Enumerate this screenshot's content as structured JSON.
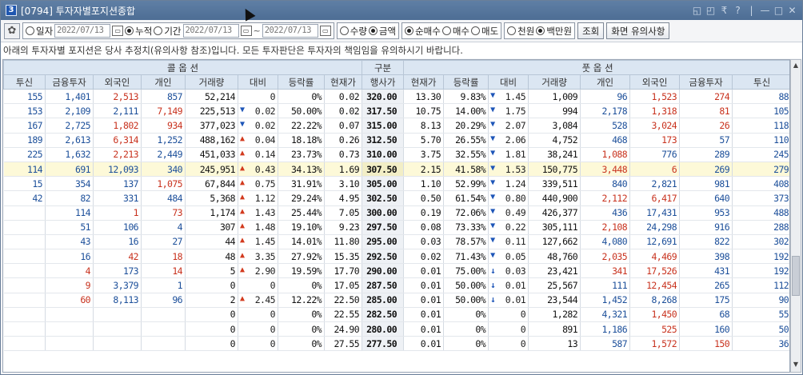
{
  "window": {
    "badge": "3",
    "title": "[0794] 투자자별포지션종합",
    "controls": [
      "◱",
      "◰",
      "₹",
      "?",
      "|",
      "—",
      "□",
      "✕"
    ]
  },
  "toolbar": {
    "gear_icon": "✿",
    "date_mode": {
      "options": [
        {
          "label": "일자",
          "selected": false
        },
        {
          "label": "누적",
          "selected": true
        },
        {
          "label": "기간",
          "selected": false
        }
      ]
    },
    "date_single": "2022/07/13",
    "date_from": "2022/07/13",
    "date_sep": "~",
    "date_to": "2022/07/13",
    "qty_mode": {
      "options": [
        {
          "label": "수량",
          "selected": false
        },
        {
          "label": "금액",
          "selected": true
        }
      ]
    },
    "trade_mode": {
      "options": [
        {
          "label": "순매수",
          "selected": true
        },
        {
          "label": "매수",
          "selected": false
        },
        {
          "label": "매도",
          "selected": false
        }
      ]
    },
    "unit_mode": {
      "options": [
        {
          "label": "천원",
          "selected": false
        },
        {
          "label": "백만원",
          "selected": true
        }
      ]
    },
    "search_label": "조회",
    "notice_label": "화면 유의사항"
  },
  "notice": "아래의 투자자별 포지션은 당사 추정치(유의사항 참조)입니다. 모든 투자판단은 투자자의 책임임을 유의하시기 바랍니다.",
  "table": {
    "group_headers": {
      "call": "콜 옵 션",
      "mid": "구분",
      "put": "풋 옵 션"
    },
    "columns": [
      "투신",
      "금융투자",
      "외국인",
      "개인",
      "거래량",
      "대비",
      "등락률",
      "현재가",
      "행사가",
      "현재가",
      "등락률",
      "대비",
      "거래량",
      "개인",
      "외국인",
      "금융투자",
      "투신"
    ],
    "rows": [
      {
        "c": [
          [
            "155",
            "b"
          ],
          [
            "1,401",
            "b"
          ],
          [
            "2,513",
            "r"
          ],
          [
            "857",
            "b"
          ],
          [
            "52,214",
            "k"
          ]
        ],
        "cd": [
          "",
          "0"
        ],
        "cr": "0%",
        "cp": "0.02",
        "strike": "320.00",
        "pp": "13.30",
        "pr": "9.83%",
        "pd": [
          "▼",
          "1.45"
        ],
        "p": [
          [
            "1,009",
            "k"
          ],
          [
            "96",
            "b"
          ],
          [
            "1,523",
            "r"
          ],
          [
            "274",
            "r"
          ],
          [
            "88",
            "b"
          ]
        ]
      },
      {
        "c": [
          [
            "153",
            "b"
          ],
          [
            "2,109",
            "b"
          ],
          [
            "2,111",
            "b"
          ],
          [
            "7,149",
            "r"
          ],
          [
            "225,513",
            "k"
          ]
        ],
        "cd": [
          "▼",
          "0.02"
        ],
        "cr": "50.00%",
        "cp": "0.02",
        "strike": "317.50",
        "pp": "10.75",
        "pr": "14.00%",
        "pd": [
          "▼",
          "1.75"
        ],
        "p": [
          [
            "994",
            "k"
          ],
          [
            "2,178",
            "b"
          ],
          [
            "1,318",
            "r"
          ],
          [
            "81",
            "r"
          ],
          [
            "105",
            "b"
          ]
        ]
      },
      {
        "c": [
          [
            "167",
            "b"
          ],
          [
            "2,725",
            "b"
          ],
          [
            "1,802",
            "r"
          ],
          [
            "934",
            "r"
          ],
          [
            "377,023",
            "k"
          ]
        ],
        "cd": [
          "▼",
          "0.02"
        ],
        "cr": "22.22%",
        "cp": "0.07",
        "strike": "315.00",
        "pp": "8.13",
        "pr": "20.29%",
        "pd": [
          "▼",
          "2.07"
        ],
        "p": [
          [
            "3,084",
            "k"
          ],
          [
            "528",
            "b"
          ],
          [
            "3,024",
            "r"
          ],
          [
            "26",
            "r"
          ],
          [
            "118",
            "b"
          ]
        ]
      },
      {
        "c": [
          [
            "189",
            "b"
          ],
          [
            "2,613",
            "b"
          ],
          [
            "6,314",
            "r"
          ],
          [
            "1,252",
            "b"
          ],
          [
            "488,162",
            "k"
          ]
        ],
        "cd": [
          "▲",
          "0.04"
        ],
        "cr": "18.18%",
        "cp": "0.26",
        "strike": "312.50",
        "pp": "5.70",
        "pr": "26.55%",
        "pd": [
          "▼",
          "2.06"
        ],
        "p": [
          [
            "4,752",
            "k"
          ],
          [
            "468",
            "b"
          ],
          [
            "173",
            "r"
          ],
          [
            "57",
            "b"
          ],
          [
            "110",
            "b"
          ]
        ]
      },
      {
        "c": [
          [
            "225",
            "b"
          ],
          [
            "1,632",
            "b"
          ],
          [
            "2,213",
            "r"
          ],
          [
            "2,449",
            "b"
          ],
          [
            "451,033",
            "k"
          ]
        ],
        "cd": [
          "▲",
          "0.14"
        ],
        "cr": "23.73%",
        "cp": "0.73",
        "strike": "310.00",
        "pp": "3.75",
        "pr": "32.55%",
        "pd": [
          "▼",
          "1.81"
        ],
        "p": [
          [
            "38,241",
            "k"
          ],
          [
            "1,088",
            "r"
          ],
          [
            "776",
            "b"
          ],
          [
            "289",
            "b"
          ],
          [
            "245",
            "b"
          ]
        ]
      },
      {
        "hl": true,
        "c": [
          [
            "114",
            "b"
          ],
          [
            "691",
            "b"
          ],
          [
            "12,093",
            "b"
          ],
          [
            "340",
            "b"
          ],
          [
            "245,951",
            "k"
          ]
        ],
        "cd": [
          "▲",
          "0.43"
        ],
        "cr": "34.13%",
        "cp": "1.69",
        "strike": "307.50",
        "pp": "2.15",
        "pr": "41.58%",
        "pd": [
          "▼",
          "1.53"
        ],
        "p": [
          [
            "150,775",
            "k"
          ],
          [
            "3,448",
            "r"
          ],
          [
            "6",
            "r"
          ],
          [
            "269",
            "b"
          ],
          [
            "279",
            "b"
          ]
        ]
      },
      {
        "c": [
          [
            "15",
            "b"
          ],
          [
            "354",
            "b"
          ],
          [
            "137",
            "b"
          ],
          [
            "1,075",
            "r"
          ],
          [
            "67,844",
            "k"
          ]
        ],
        "cd": [
          "▲",
          "0.75"
        ],
        "cr": "31.91%",
        "cp": "3.10",
        "strike": "305.00",
        "pp": "1.10",
        "pr": "52.99%",
        "pd": [
          "▼",
          "1.24"
        ],
        "p": [
          [
            "339,511",
            "k"
          ],
          [
            "840",
            "b"
          ],
          [
            "2,821",
            "b"
          ],
          [
            "981",
            "b"
          ],
          [
            "408",
            "b"
          ]
        ]
      },
      {
        "c": [
          [
            "42",
            "b"
          ],
          [
            "82",
            "b"
          ],
          [
            "331",
            "b"
          ],
          [
            "484",
            "b"
          ],
          [
            "5,368",
            "k"
          ]
        ],
        "cd": [
          "▲",
          "1.12"
        ],
        "cr": "29.24%",
        "cp": "4.95",
        "strike": "302.50",
        "pp": "0.50",
        "pr": "61.54%",
        "pd": [
          "▼",
          "0.80"
        ],
        "p": [
          [
            "440,900",
            "k"
          ],
          [
            "2,112",
            "r"
          ],
          [
            "6,417",
            "r"
          ],
          [
            "640",
            "b"
          ],
          [
            "373",
            "b"
          ]
        ]
      },
      {
        "c": [
          [
            "",
            ""
          ],
          [
            "114",
            "b"
          ],
          [
            "1",
            "r"
          ],
          [
            "73",
            "r"
          ],
          [
            "1,174",
            "k"
          ]
        ],
        "cd": [
          "▲",
          "1.43"
        ],
        "cr": "25.44%",
        "cp": "7.05",
        "strike": "300.00",
        "pp": "0.19",
        "pr": "72.06%",
        "pd": [
          "▼",
          "0.49"
        ],
        "p": [
          [
            "426,377",
            "k"
          ],
          [
            "436",
            "b"
          ],
          [
            "17,431",
            "b"
          ],
          [
            "953",
            "b"
          ],
          [
            "488",
            "b"
          ]
        ]
      },
      {
        "c": [
          [
            "",
            ""
          ],
          [
            "51",
            "b"
          ],
          [
            "106",
            "b"
          ],
          [
            "4",
            "b"
          ],
          [
            "307",
            "k"
          ]
        ],
        "cd": [
          "▲",
          "1.48"
        ],
        "cr": "19.10%",
        "cp": "9.23",
        "strike": "297.50",
        "pp": "0.08",
        "pr": "73.33%",
        "pd": [
          "▼",
          "0.22"
        ],
        "p": [
          [
            "305,111",
            "k"
          ],
          [
            "2,108",
            "r"
          ],
          [
            "24,298",
            "b"
          ],
          [
            "916",
            "b"
          ],
          [
            "288",
            "b"
          ]
        ]
      },
      {
        "c": [
          [
            "",
            ""
          ],
          [
            "43",
            "b"
          ],
          [
            "16",
            "b"
          ],
          [
            "27",
            "b"
          ],
          [
            "44",
            "k"
          ]
        ],
        "cd": [
          "▲",
          "1.45"
        ],
        "cr": "14.01%",
        "cp": "11.80",
        "strike": "295.00",
        "pp": "0.03",
        "pr": "78.57%",
        "pd": [
          "▼",
          "0.11"
        ],
        "p": [
          [
            "127,662",
            "k"
          ],
          [
            "4,080",
            "b"
          ],
          [
            "12,691",
            "b"
          ],
          [
            "822",
            "b"
          ],
          [
            "302",
            "b"
          ]
        ]
      },
      {
        "c": [
          [
            "",
            ""
          ],
          [
            "16",
            "b"
          ],
          [
            "42",
            "r"
          ],
          [
            "18",
            "r"
          ],
          [
            "48",
            "k"
          ]
        ],
        "cd": [
          "▲",
          "3.35"
        ],
        "cr": "27.92%",
        "cp": "15.35",
        "strike": "292.50",
        "pp": "0.02",
        "pr": "71.43%",
        "pd": [
          "▼",
          "0.05"
        ],
        "p": [
          [
            "48,760",
            "k"
          ],
          [
            "2,035",
            "r"
          ],
          [
            "4,469",
            "r"
          ],
          [
            "398",
            "b"
          ],
          [
            "192",
            "b"
          ]
        ]
      },
      {
        "c": [
          [
            "",
            ""
          ],
          [
            "4",
            "r"
          ],
          [
            "173",
            "b"
          ],
          [
            "14",
            "r"
          ],
          [
            "5",
            "k"
          ]
        ],
        "cd": [
          "▲",
          "2.90"
        ],
        "cr": "19.59%",
        "cp": "17.70",
        "strike": "290.00",
        "pp": "0.01",
        "pr": "75.00%",
        "pd": [
          "↓",
          "0.03"
        ],
        "p": [
          [
            "23,421",
            "k"
          ],
          [
            "341",
            "r"
          ],
          [
            "17,526",
            "r"
          ],
          [
            "431",
            "b"
          ],
          [
            "192",
            "b"
          ]
        ]
      },
      {
        "c": [
          [
            "",
            ""
          ],
          [
            "9",
            "r"
          ],
          [
            "3,379",
            "b"
          ],
          [
            "1",
            "b"
          ],
          [
            "0",
            "k"
          ]
        ],
        "cd": [
          "",
          "0"
        ],
        "cr": "0%",
        "cp": "17.05",
        "strike": "287.50",
        "pp": "0.01",
        "pr": "50.00%",
        "pd": [
          "↓",
          "0.01"
        ],
        "p": [
          [
            "25,567",
            "k"
          ],
          [
            "111",
            "b"
          ],
          [
            "12,454",
            "r"
          ],
          [
            "265",
            "b"
          ],
          [
            "112",
            "b"
          ]
        ]
      },
      {
        "c": [
          [
            "",
            ""
          ],
          [
            "60",
            "r"
          ],
          [
            "8,113",
            "b"
          ],
          [
            "96",
            "b"
          ],
          [
            "2",
            "k"
          ]
        ],
        "cd": [
          "▲",
          "2.45"
        ],
        "cr": "12.22%",
        "cp": "22.50",
        "strike": "285.00",
        "pp": "0.01",
        "pr": "50.00%",
        "pd": [
          "↓",
          "0.01"
        ],
        "p": [
          [
            "23,544",
            "k"
          ],
          [
            "1,452",
            "b"
          ],
          [
            "8,268",
            "b"
          ],
          [
            "175",
            "b"
          ],
          [
            "90",
            "b"
          ]
        ]
      },
      {
        "c": [
          [
            "",
            ""
          ],
          [
            "",
            ""
          ],
          [
            "",
            ""
          ],
          [
            "",
            ""
          ],
          [
            "0",
            "k"
          ]
        ],
        "cd": [
          "",
          "0"
        ],
        "cr": "0%",
        "cp": "22.55",
        "strike": "282.50",
        "pp": "0.01",
        "pr": "0%",
        "pd": [
          "",
          "0"
        ],
        "p": [
          [
            "1,282",
            "k"
          ],
          [
            "4,321",
            "b"
          ],
          [
            "1,450",
            "r"
          ],
          [
            "68",
            "b"
          ],
          [
            "55",
            "b"
          ]
        ]
      },
      {
        "c": [
          [
            "",
            ""
          ],
          [
            "",
            ""
          ],
          [
            "",
            ""
          ],
          [
            "",
            ""
          ],
          [
            "0",
            "k"
          ]
        ],
        "cd": [
          "",
          "0"
        ],
        "cr": "0%",
        "cp": "24.90",
        "strike": "280.00",
        "pp": "0.01",
        "pr": "0%",
        "pd": [
          "",
          "0"
        ],
        "p": [
          [
            "891",
            "k"
          ],
          [
            "1,186",
            "b"
          ],
          [
            "525",
            "r"
          ],
          [
            "160",
            "b"
          ],
          [
            "50",
            "b"
          ]
        ]
      },
      {
        "c": [
          [
            "",
            ""
          ],
          [
            "",
            ""
          ],
          [
            "",
            ""
          ],
          [
            "",
            ""
          ],
          [
            "0",
            "k"
          ]
        ],
        "cd": [
          "",
          "0"
        ],
        "cr": "0%",
        "cp": "27.55",
        "strike": "277.50",
        "pp": "0.01",
        "pr": "0%",
        "pd": [
          "",
          "0"
        ],
        "p": [
          [
            "13",
            "k"
          ],
          [
            "587",
            "b"
          ],
          [
            "1,572",
            "r"
          ],
          [
            "150",
            "r"
          ],
          [
            "36",
            "b"
          ]
        ]
      }
    ]
  }
}
